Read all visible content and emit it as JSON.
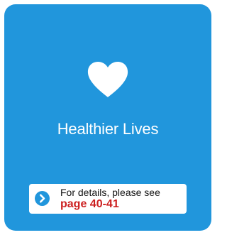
{
  "tile": {
    "title": "Healthier Lives",
    "icon": "heart-icon",
    "background_color": "#2196dc"
  },
  "callout": {
    "intro_text": "For details, please see",
    "page_ref": "page 40-41",
    "icon": "chevron-right-circle-icon",
    "link_color": "#cc1f1f"
  }
}
